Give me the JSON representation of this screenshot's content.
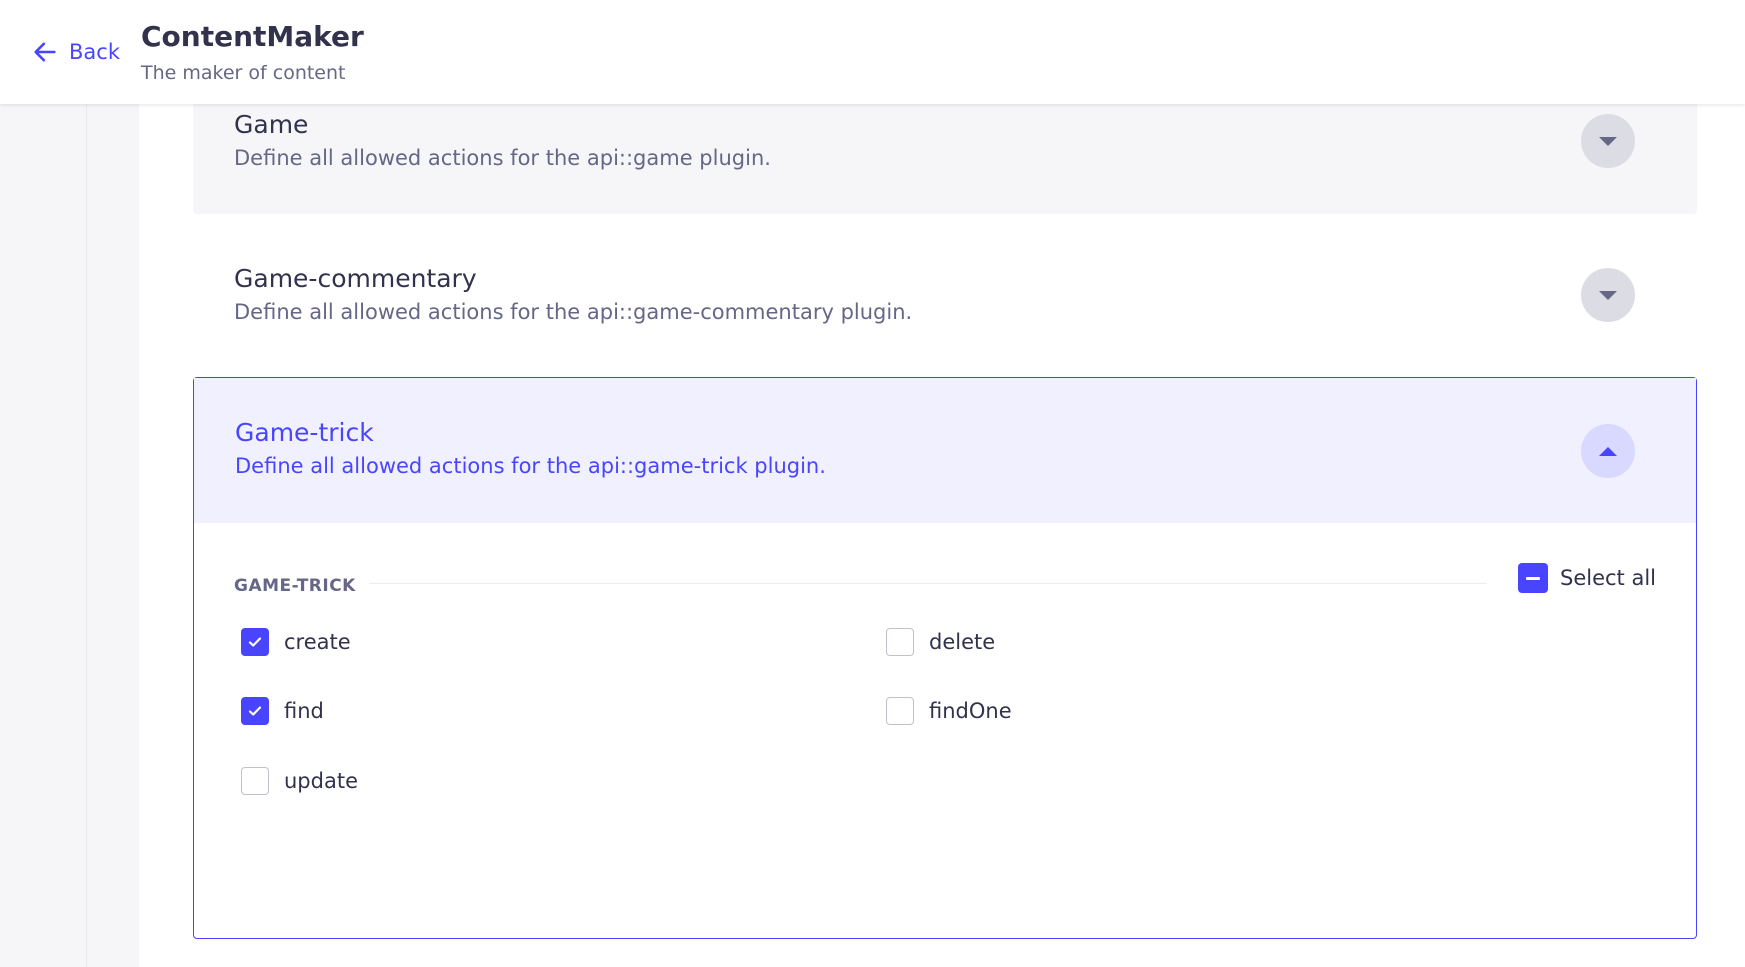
{
  "header": {
    "back_label": "Back",
    "title": "ContentMaker",
    "subtitle": "The maker of content"
  },
  "accordions": [
    {
      "title": "Game",
      "description": "Define all allowed actions for the api::game plugin.",
      "expanded": false
    },
    {
      "title": "Game-commentary",
      "description": "Define all allowed actions for the api::game-commentary plugin.",
      "expanded": false
    },
    {
      "title": "Game-trick",
      "description": "Define all allowed actions for the api::game-trick plugin.",
      "expanded": true,
      "section_label": "GAME-TRICK",
      "select_all_label": "Select all",
      "select_all_state": "indeterminate",
      "permissions": [
        {
          "label": "create",
          "checked": true
        },
        {
          "label": "delete",
          "checked": false
        },
        {
          "label": "find",
          "checked": true
        },
        {
          "label": "findOne",
          "checked": false
        },
        {
          "label": "update",
          "checked": false
        }
      ]
    }
  ],
  "colors": {
    "primary": "#4945ff",
    "primary_light": "#f0f0ff",
    "text": "#32324d",
    "muted": "#666687"
  },
  "icons": {
    "back": "arrow-left-icon",
    "collapsed": "caret-down-icon",
    "expanded": "caret-up-icon",
    "checked": "checkmark-icon",
    "indeterminate": "minus-icon"
  }
}
